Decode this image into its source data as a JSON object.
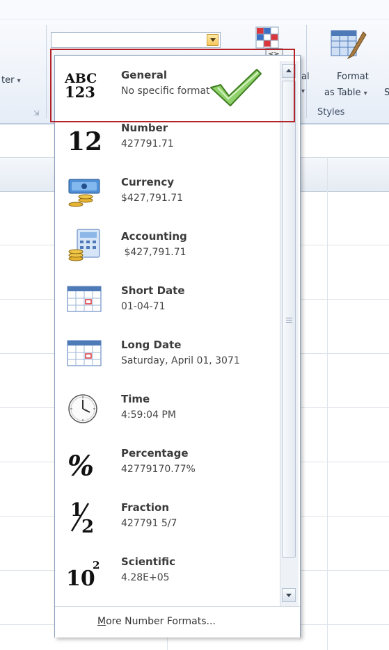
{
  "ribbon": {
    "left_button_label": "ter",
    "left_dropdown_arrow": "▾",
    "conditional_label_fragment": "al",
    "conditional_dropdown_arrow": "▾",
    "format_table_line1": "Format",
    "format_table_line2": "as Table",
    "format_table_arrow": "▾",
    "next_label_fragment": "S",
    "group_label_styles": "Styles",
    "group_launcher_icon": "dialog-launcher-icon",
    "number_format_combo_value": ""
  },
  "number_format_menu": {
    "items": [
      {
        "title": "General",
        "value": "No specific format",
        "icon": "abc-123-icon"
      },
      {
        "title": "Number",
        "value": "427791.71",
        "icon": "number-12-icon"
      },
      {
        "title": "Currency",
        "value": "$427,791.71",
        "icon": "currency-icon"
      },
      {
        "title": "Accounting",
        "value": " $427,791.71",
        "icon": "accounting-icon"
      },
      {
        "title": "Short Date",
        "value": "01-04-71",
        "icon": "calendar-icon"
      },
      {
        "title": "Long Date",
        "value": "Saturday, April 01, 3071",
        "icon": "calendar-icon"
      },
      {
        "title": "Time",
        "value": "4:59:04 PM",
        "icon": "clock-icon"
      },
      {
        "title": "Percentage",
        "value": "42779170.77%",
        "icon": "percent-icon"
      },
      {
        "title": "Fraction",
        "value": "427791 5/7",
        "icon": "fraction-icon"
      },
      {
        "title": "Scientific",
        "value": "4.28E+05",
        "icon": "scientific-icon"
      }
    ],
    "more_label": "More Number Formats...",
    "glyphs": {
      "abc": "ABC",
      "num123": "123",
      "twelve": "12",
      "percent": "%",
      "one": "1",
      "two": "2",
      "ten": "10",
      "squared": "2"
    }
  },
  "colors": {
    "highlight_border": "#b32227",
    "checkmark": "#5aa82e"
  }
}
